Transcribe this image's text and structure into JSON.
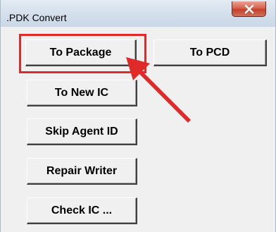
{
  "window": {
    "title": ".PDK Convert",
    "close_glyph": "x"
  },
  "buttons": {
    "to_package": "To Package",
    "to_pcd": "To PCD",
    "to_new_ic": "To New IC",
    "skip_agent_id": "Skip Agent ID",
    "repair_writer": "Repair Writer",
    "check_ic": "Check IC ..."
  },
  "annotation": {
    "color": "#e02a2a",
    "icon": "red-arrow-pointer"
  }
}
